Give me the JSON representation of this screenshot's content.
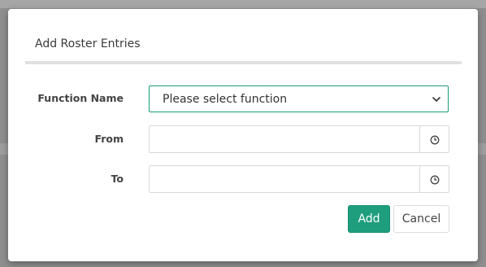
{
  "modal": {
    "title": "Add Roster Entries"
  },
  "form": {
    "function_name": {
      "label": "Function Name",
      "selected": "Please select function"
    },
    "from": {
      "label": "From",
      "value": "",
      "icon": "clock-icon"
    },
    "to": {
      "label": "To",
      "value": "",
      "icon": "clock-icon"
    }
  },
  "actions": {
    "add_label": "Add",
    "cancel_label": "Cancel"
  },
  "colors": {
    "accent": "#1f9e7e",
    "focus_border": "#1a9c7a"
  }
}
